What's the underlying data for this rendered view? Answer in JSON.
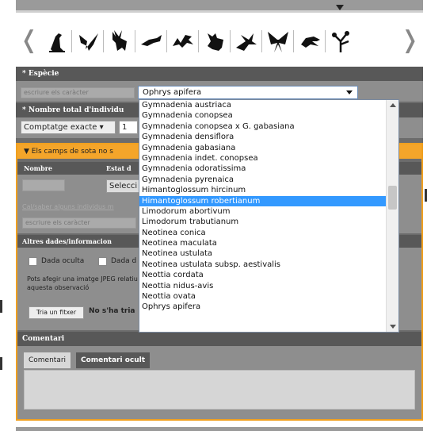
{
  "taxa": {
    "prev_icon": "chevron-left-icon",
    "next_icon": "chevron-right-icon",
    "prev_glyph": "❬",
    "next_glyph": "❭",
    "icons": [
      "bird-icon",
      "bat-icon",
      "deer-icon",
      "fish-icon",
      "lizard-icon",
      "frog-icon",
      "dragonfly-icon",
      "butterfly-icon",
      "beetle-icon",
      "orchid-plant-icon"
    ]
  },
  "especie": {
    "header": "* Espècie",
    "filter_placeholder": "escriure els caràcter",
    "selected": "Ophrys apifera"
  },
  "count": {
    "header": "* Nombre total d'individu",
    "type": "Comptatge exacte ▾",
    "value": "1"
  },
  "warning": {
    "text": "▼  Els camps de sota no s",
    "col_nombre": "Nombre",
    "col_estat": "Estat d",
    "estat_button": "Selecci",
    "add_link": "Cal/saber alguns individus m",
    "filter_placeholder": "escriure els caràcter"
  },
  "altres": {
    "header": "Altres dades/informacion",
    "check1": "Dada oculta",
    "check2": "Dada d",
    "note": "Pots afegir una imatge JPEG relatiu a aquesta observació",
    "file_button": "Tria un fitxer",
    "file_none": "No s'ha tria"
  },
  "comentari": {
    "header": "Comentari",
    "tab1": "Comentari",
    "tab2": "Comentari ocult"
  },
  "dropdown": {
    "selected_index": 10,
    "items": [
      "Gymnadenia austriaca",
      "Gymnadenia conopsea",
      "Gymnadenia conopsea x G. gabasiana",
      "Gymnadenia densiflora",
      "Gymnadenia gabasiana",
      "Gymnadenia indet. conopsea",
      "Gymnadenia odoratissima",
      "Gymnadenia pyrenaica",
      "Himantoglossum hircinum",
      "Himantoglossum robertianum",
      "Limodorum abortivum",
      "Limodorum trabutianum",
      "Neotinea conica",
      "Neotinea maculata",
      "Neotinea ustulata",
      "Neotinea ustulata subsp. aestivalis",
      "Neottia cordata",
      "Neottia nidus-avis",
      "Neottia ovata",
      "Ophrys apifera"
    ]
  }
}
